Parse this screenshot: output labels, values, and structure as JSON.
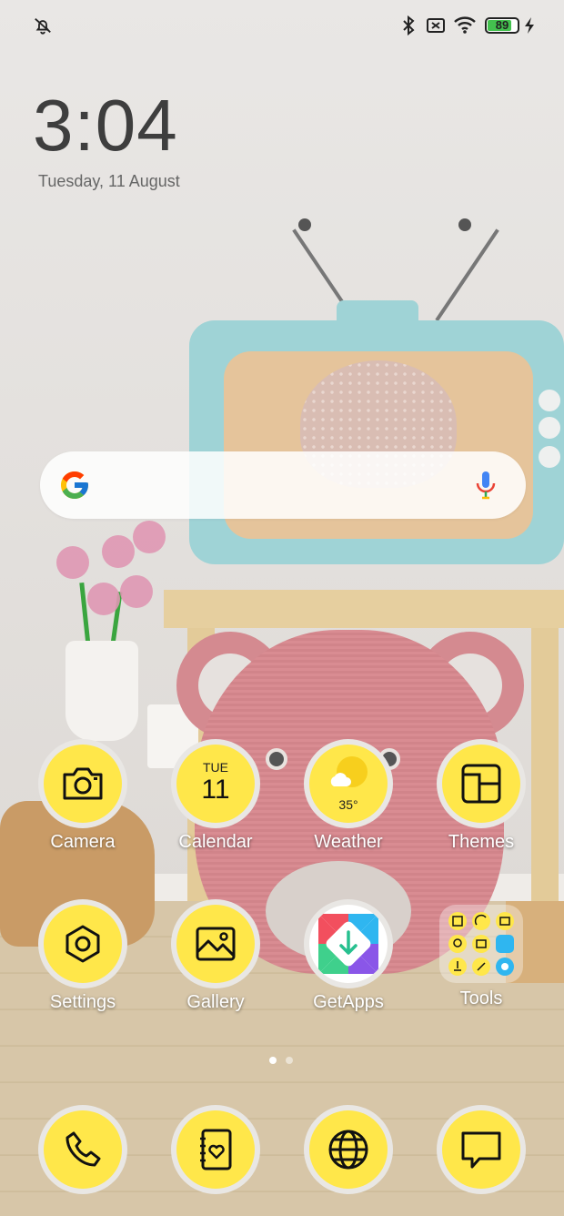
{
  "status_bar": {
    "battery_level": "89"
  },
  "lock_clock": {
    "time": "3:04",
    "date": "Tuesday, 11 August"
  },
  "search": {
    "google_icon": "google-g-icon",
    "mic_icon": "mic-icon"
  },
  "apps_row1": [
    {
      "label": "Camera",
      "icon": "camera-icon"
    },
    {
      "label": "Calendar",
      "icon": "calendar-icon",
      "day": "TUE",
      "date": "11"
    },
    {
      "label": "Weather",
      "icon": "weather-icon",
      "temp": "35°"
    },
    {
      "label": "Themes",
      "icon": "themes-icon"
    }
  ],
  "apps_row2": [
    {
      "label": "Settings",
      "icon": "settings-icon"
    },
    {
      "label": "Gallery",
      "icon": "gallery-icon"
    },
    {
      "label": "GetApps",
      "icon": "getapps-icon"
    },
    {
      "label": "Tools",
      "icon": "tools-folder-icon"
    }
  ],
  "dock": [
    {
      "icon": "phone-icon"
    },
    {
      "icon": "contacts-icon"
    },
    {
      "icon": "browser-icon"
    },
    {
      "icon": "messages-icon"
    }
  ],
  "page_indicator": {
    "pages": 2,
    "current": 1
  },
  "colors": {
    "icon_yellow": "#ffe74a",
    "battery_green": "#43c14e"
  }
}
